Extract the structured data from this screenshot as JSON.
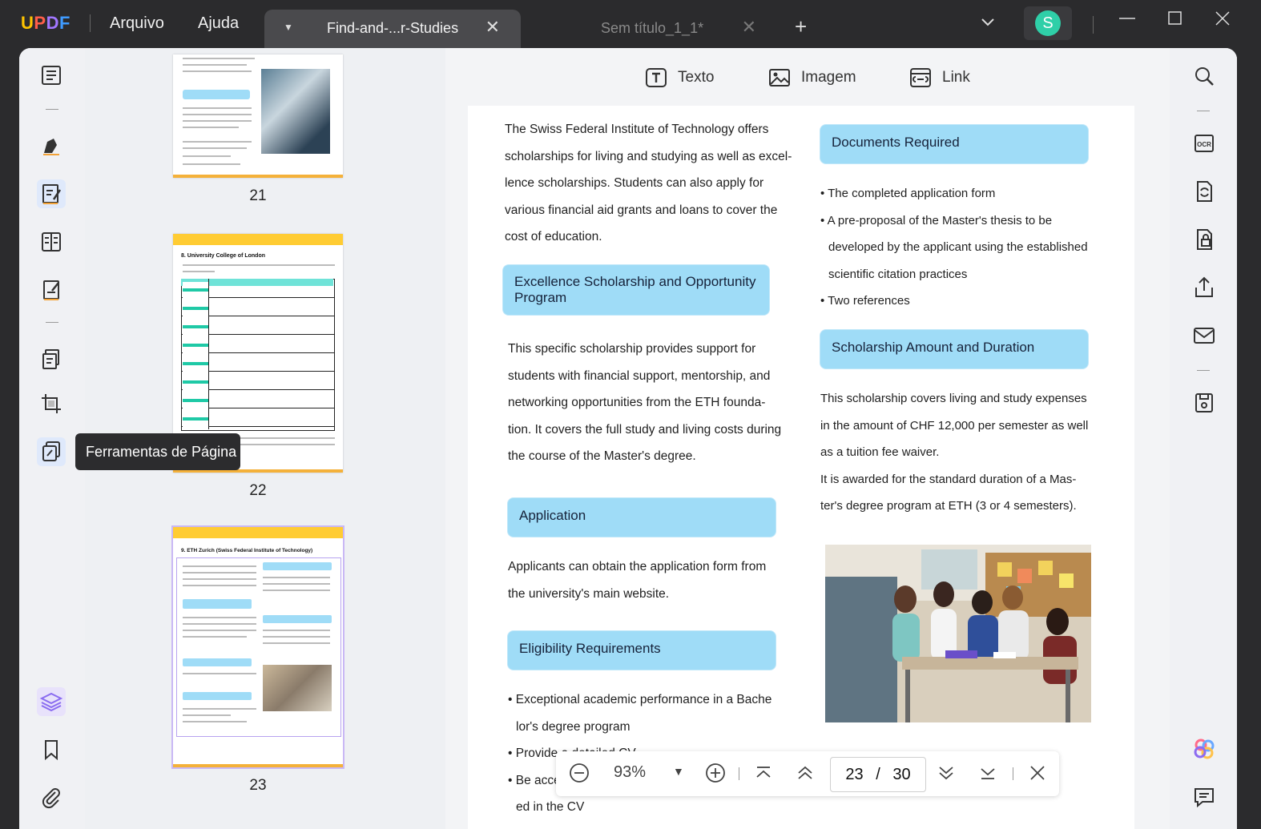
{
  "app": {
    "logo": "UPDF",
    "menu": [
      "Arquivo",
      "Ajuda"
    ],
    "tabs": [
      {
        "title": "Find-and-...r-Studies",
        "active": true
      },
      {
        "title": "Sem título_1_1*",
        "active": false
      }
    ],
    "avatar_initial": "S",
    "accent": "#2fcfa8"
  },
  "left_sidebar": {
    "tooltip": "Ferramentas de Página",
    "icons": [
      "reader-icon",
      "comment-icon",
      "edit-pdf-icon",
      "organize-icon",
      "fill-sign-icon",
      "convert-pages-icon",
      "crop-icon",
      "page-tools-icon",
      "layers-icon",
      "bookmark-icon",
      "attachment-icon"
    ]
  },
  "thumbnails": {
    "pages": [
      {
        "number": "21"
      },
      {
        "number": "22",
        "heading": "8. University College of London"
      },
      {
        "number": "23",
        "heading": "9. ETH Zurich (Swiss Federal Institute of Technology)",
        "selected": true
      }
    ]
  },
  "edit_toolbar": {
    "text": "Texto",
    "image": "Imagem",
    "link": "Link"
  },
  "document": {
    "left": {
      "intro": [
        "The Swiss Federal Institute of Technology offers",
        "scholarships for living and studying as well as excel-",
        "lence scholarships. Students can also apply for",
        "various financial aid grants and loans to cover the",
        "cost of education."
      ],
      "excellence_heading": "Excellence Scholarship and Opportunity Program",
      "excellence_text": [
        "This specific scholarship provides support for",
        "students with financial support, mentorship, and",
        "networking opportunities from the ETH founda-",
        "tion. It covers the full study and living costs during",
        "the course of the Master's degree."
      ],
      "application_heading": "Application",
      "application_text": [
        "Applicants can obtain the application form from",
        "the university's main website."
      ],
      "eligibility_heading": "Eligibility Requirements",
      "eligibility_items": [
        "• Exceptional academic performance in a Bache",
        "lor's degree program",
        "• Provide a detailed CV",
        "• Be accepted",
        "ed in the CV"
      ]
    },
    "right": {
      "documents_heading": "Documents Required",
      "documents_items": [
        "• The completed application form",
        "• A pre-proposal of the Master's thesis to be",
        "developed by the applicant using the established",
        "scientific citation practices",
        "• Two references"
      ],
      "amount_heading": "Scholarship Amount and Duration",
      "amount_text": [
        "This scholarship covers living and study expenses",
        "in the amount of CHF 12,000 per semester as well",
        "as a tuition fee waiver.",
        "It is awarded for the standard duration of a Mas-",
        "ter's degree program at ETH (3 or 4 semesters)."
      ]
    }
  },
  "zoom_bar": {
    "zoom": "93%",
    "current_page": "23",
    "separator": "/",
    "total_pages": "30"
  },
  "right_sidebar": {
    "icons": [
      "search-icon",
      "ocr-icon",
      "convert-icon",
      "protect-icon",
      "share-icon",
      "email-icon",
      "save-icon",
      "ai-assistant-icon",
      "comments-panel-icon"
    ]
  }
}
